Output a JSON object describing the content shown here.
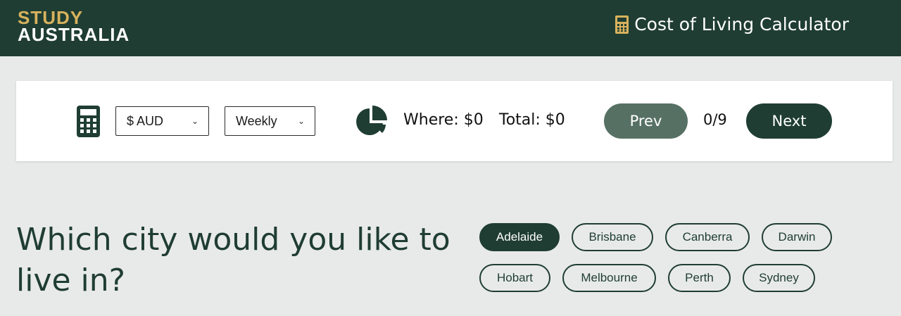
{
  "header": {
    "logo_top": "STUDY",
    "logo_bottom": "AUSTRALIA",
    "title": "Cost of Living Calculator",
    "title_icon": "calculator-icon"
  },
  "toolbar": {
    "calculator_icon": "calculator-icon",
    "currency": {
      "selected": "$ AUD"
    },
    "period": {
      "selected": "Weekly"
    },
    "chart_icon": "pie-chart-icon",
    "where_label": "Where: $0",
    "total_label": "Total: $0",
    "prev_label": "Prev",
    "counter": "0/9",
    "next_label": "Next"
  },
  "question": "Which city would you like to live in?",
  "cities": [
    {
      "label": "Adelaide",
      "selected": true
    },
    {
      "label": "Brisbane",
      "selected": false
    },
    {
      "label": "Canberra",
      "selected": false
    },
    {
      "label": "Darwin",
      "selected": false
    },
    {
      "label": "Hobart",
      "selected": false
    },
    {
      "label": "Melbourne",
      "selected": false
    },
    {
      "label": "Perth",
      "selected": false
    },
    {
      "label": "Sydney",
      "selected": false
    }
  ],
  "colors": {
    "brand_dark": "#1f3d33",
    "brand_gold": "#d8b25c",
    "prev_button": "#567164",
    "background": "#e8eae9"
  }
}
